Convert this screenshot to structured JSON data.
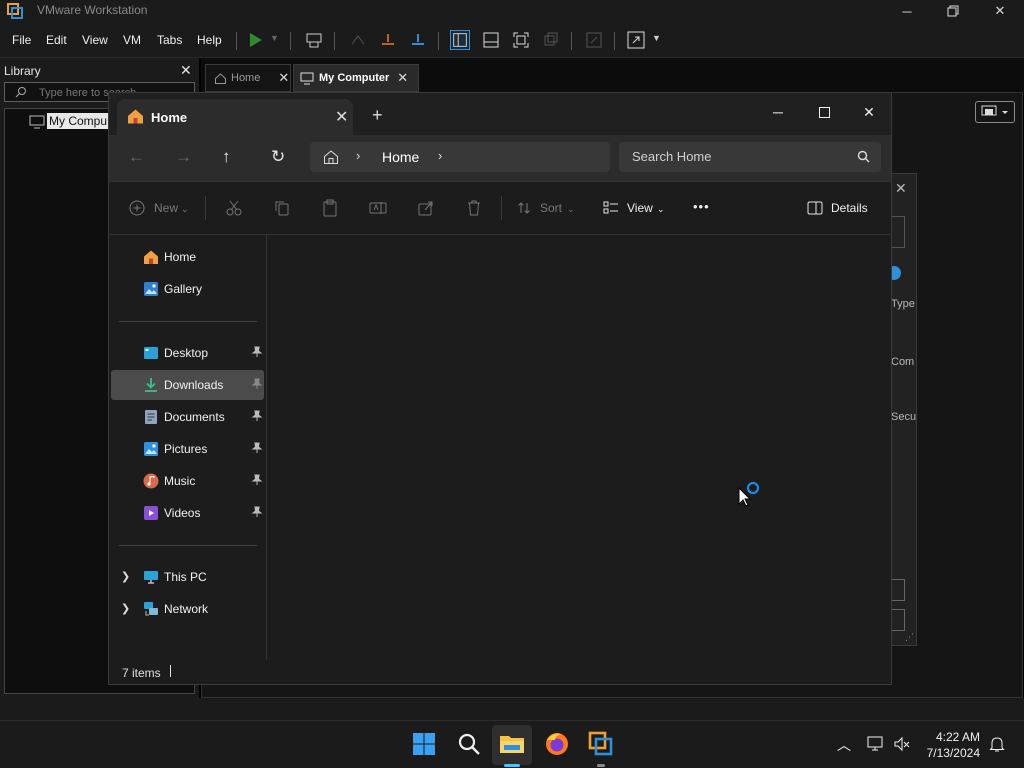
{
  "vmware": {
    "title": "VMware Workstation",
    "menu": [
      "File",
      "Edit",
      "View",
      "VM",
      "Tabs",
      "Help"
    ],
    "library": {
      "title": "Library",
      "search_placeholder": "Type here to search",
      "tree_item": "My Compu"
    },
    "tabs": [
      {
        "label": "Home"
      },
      {
        "label": "My Computer"
      }
    ],
    "background_dialog": {
      "labels": [
        "Type",
        "Com",
        "Secu"
      ]
    }
  },
  "explorer": {
    "tab_title": "Home",
    "address": {
      "crumb": "Home"
    },
    "search_placeholder": "Search Home",
    "toolbar": {
      "new_label": "New",
      "sort_label": "Sort",
      "view_label": "View",
      "more_label": "•••",
      "details_label": "Details"
    },
    "nav": {
      "home": "Home",
      "gallery": "Gallery",
      "desktop": "Desktop",
      "downloads": "Downloads",
      "documents": "Documents",
      "pictures": "Pictures",
      "music": "Music",
      "videos": "Videos",
      "this_pc": "This PC",
      "network": "Network"
    },
    "status": "7 items"
  },
  "taskbar": {
    "time": "4:22 AM",
    "date": "7/13/2024",
    "accent": "#4cc2ff"
  }
}
